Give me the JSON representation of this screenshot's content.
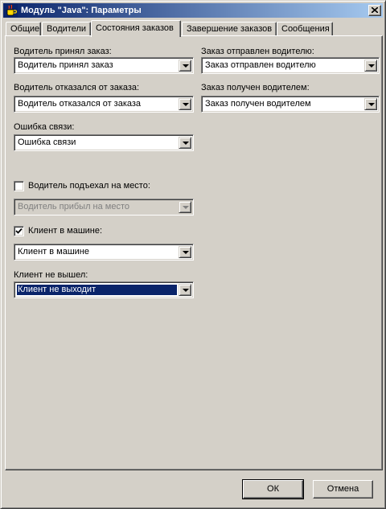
{
  "window": {
    "title": "Модуль \"Java\": Параметры",
    "close_glyph": "✕",
    "icon": "java-cup-icon"
  },
  "tabs": [
    {
      "label": "Общие",
      "active": false
    },
    {
      "label": "Водители",
      "active": false
    },
    {
      "label": "Состояния заказов",
      "active": true
    },
    {
      "label": "Завершение заказов",
      "active": false
    },
    {
      "label": "Сообщения",
      "active": false
    }
  ],
  "fields": {
    "driver_accepted": {
      "label": "Водитель принял заказ:",
      "value": "Водитель принял заказ"
    },
    "order_sent": {
      "label": "Заказ отправлен водителю:",
      "value": "Заказ отправлен водителю"
    },
    "driver_refused": {
      "label": "Водитель отказался от заказа:",
      "value": "Водитель отказался от заказа"
    },
    "order_received": {
      "label": "Заказ получен водителем:",
      "value": "Заказ получен водителем"
    },
    "connection_error": {
      "label": "Ошибка связи:",
      "value": "Ошибка связи"
    },
    "driver_arrived": {
      "label": "Водитель подъехал на место:",
      "value": "Водитель прибыл на место",
      "checked": false
    },
    "client_in_car": {
      "label": "Клиент в машине:",
      "value": "Клиент в машине",
      "checked": true
    },
    "client_no_show": {
      "label": "Клиент не вышел:",
      "value": "Клиент не выходит"
    }
  },
  "buttons": {
    "ok": "ОК",
    "cancel": "Отмена"
  },
  "colors": {
    "title_start": "#0a246a",
    "title_end": "#a6caf0",
    "face": "#d4d0c8",
    "selection": "#0a246a"
  }
}
